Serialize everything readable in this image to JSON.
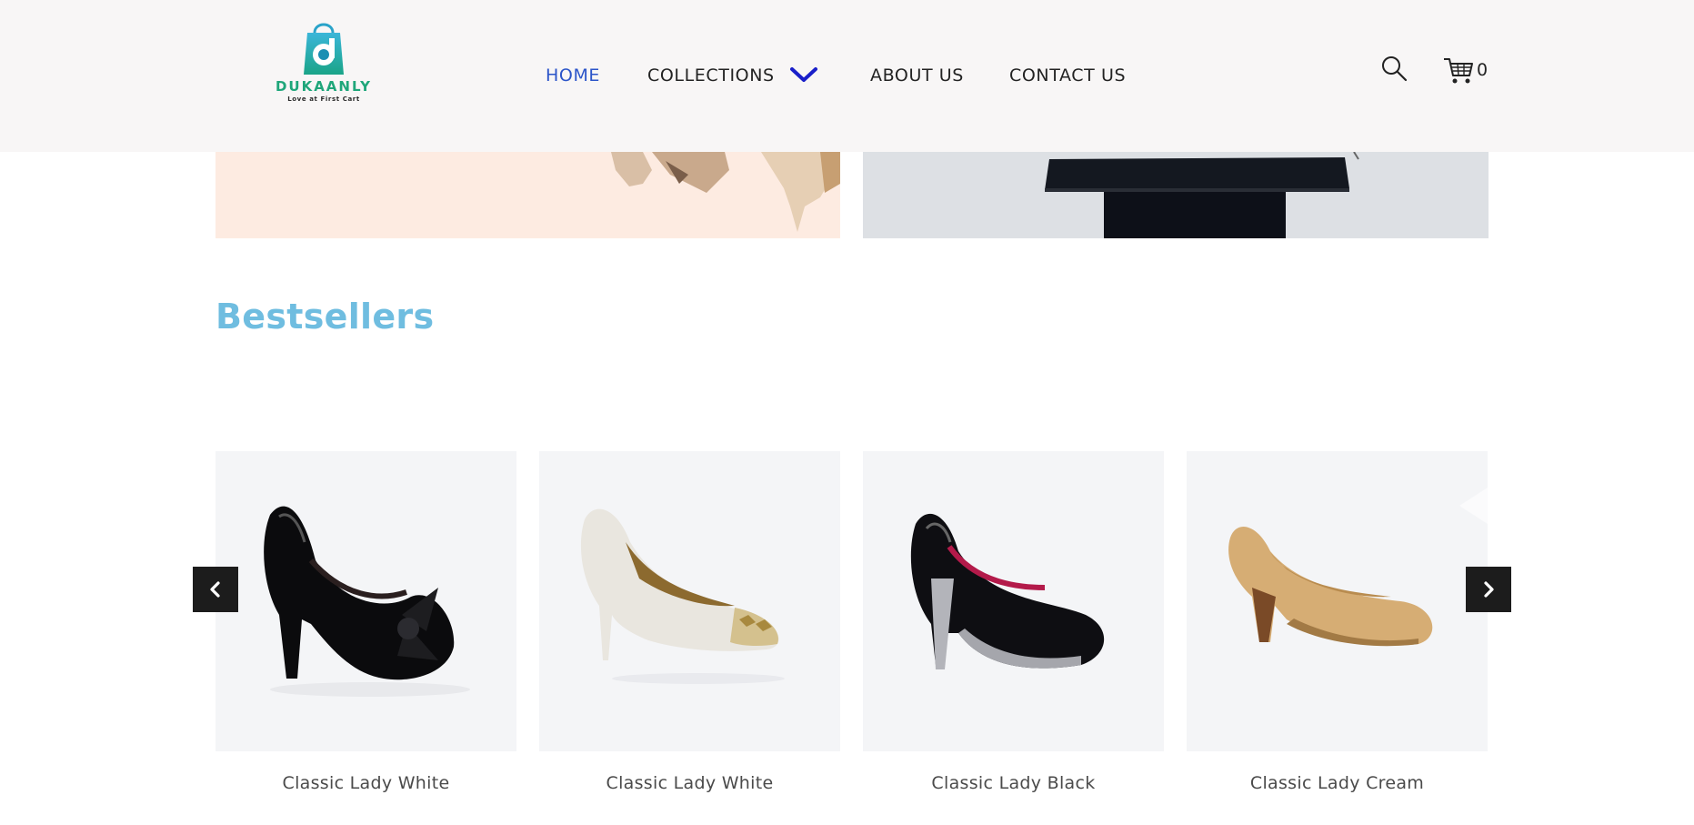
{
  "header": {
    "logo": {
      "brand_name": "DUKAANLY",
      "tagline": "Love at First Cart",
      "icon": "shopping-bag-logo-icon"
    },
    "nav": [
      {
        "label": "HOME",
        "active": true
      },
      {
        "label": "COLLECTIONS",
        "has_dropdown": true,
        "icon": "chevron-down-icon"
      },
      {
        "label": "ABOUT US"
      },
      {
        "label": "CONTACT US"
      }
    ],
    "search_icon": "search-icon",
    "cart": {
      "icon": "cart-icon",
      "count": "0"
    }
  },
  "bestsellers": {
    "title": "Bestsellers",
    "prev_icon": "chevron-left-icon",
    "next_icon": "chevron-right-icon",
    "products": [
      {
        "name": "Classic Lady White"
      },
      {
        "name": "Classic Lady White"
      },
      {
        "name": "Classic Lady Black"
      },
      {
        "name": "Classic Lady Cream"
      }
    ]
  },
  "colors": {
    "nav_active": "#2c55c9",
    "title": "#6fbde0",
    "header_bg": "#f8f6f6",
    "chevron": "#1a1fc9"
  }
}
